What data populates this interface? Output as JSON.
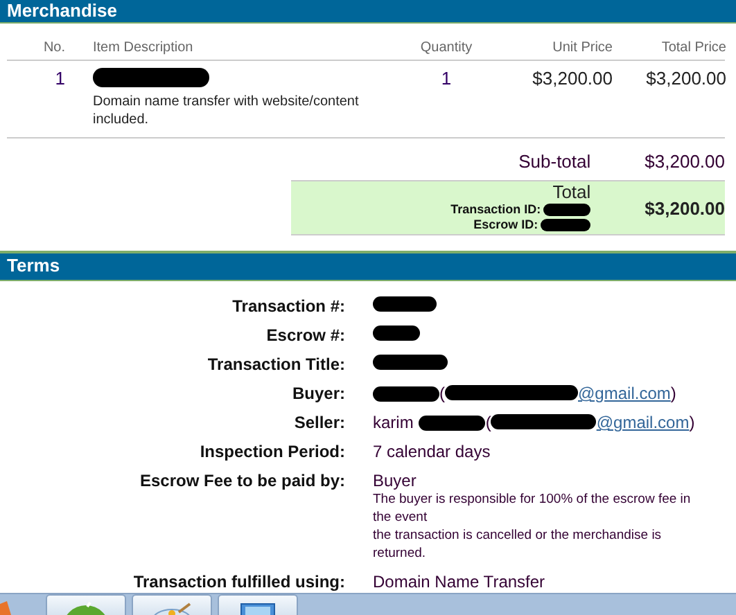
{
  "merchandise": {
    "title": "Merchandise",
    "columns": [
      "No.",
      "Item Description",
      "Quantity",
      "Unit Price",
      "Total Price"
    ],
    "rows": [
      {
        "no": "1",
        "description": "Domain name transfer with website/content included.",
        "quantity": "1",
        "unit_price": "$3,200.00",
        "total_price": "$3,200.00"
      }
    ],
    "subtotal": {
      "label": "Sub-total",
      "value": "$3,200.00"
    },
    "total": {
      "label": "Total",
      "transaction_id_label": "Transaction ID:",
      "escrow_id_label": "Escrow ID:",
      "value": "$3,200.00"
    }
  },
  "terms": {
    "title": "Terms",
    "rows": [
      {
        "kind": "redacted",
        "label": "Transaction #:"
      },
      {
        "kind": "redacted",
        "label": "Escrow #:"
      },
      {
        "kind": "redacted",
        "label": "Transaction Title:"
      },
      {
        "kind": "party",
        "label": "Buyer:",
        "open": "(",
        "email_suffix": "@gmail.com",
        "close": ")"
      },
      {
        "kind": "party",
        "label": "Seller:",
        "name": "karim",
        "open": "(",
        "email_suffix": "@gmail.com",
        "close": ")"
      },
      {
        "kind": "text",
        "label": "Inspection Period:",
        "value": "7 calendar days"
      },
      {
        "kind": "fee",
        "label": "Escrow Fee to be paid by:",
        "value": "Buyer",
        "note_lines": [
          "The buyer is responsible for 100% of the escrow fee in the event",
          "the transaction is cancelled or the merchandise is returned."
        ]
      },
      {
        "kind": "text",
        "label": "Transaction fulfilled using:",
        "value": "Domain Name Transfer"
      }
    ]
  }
}
